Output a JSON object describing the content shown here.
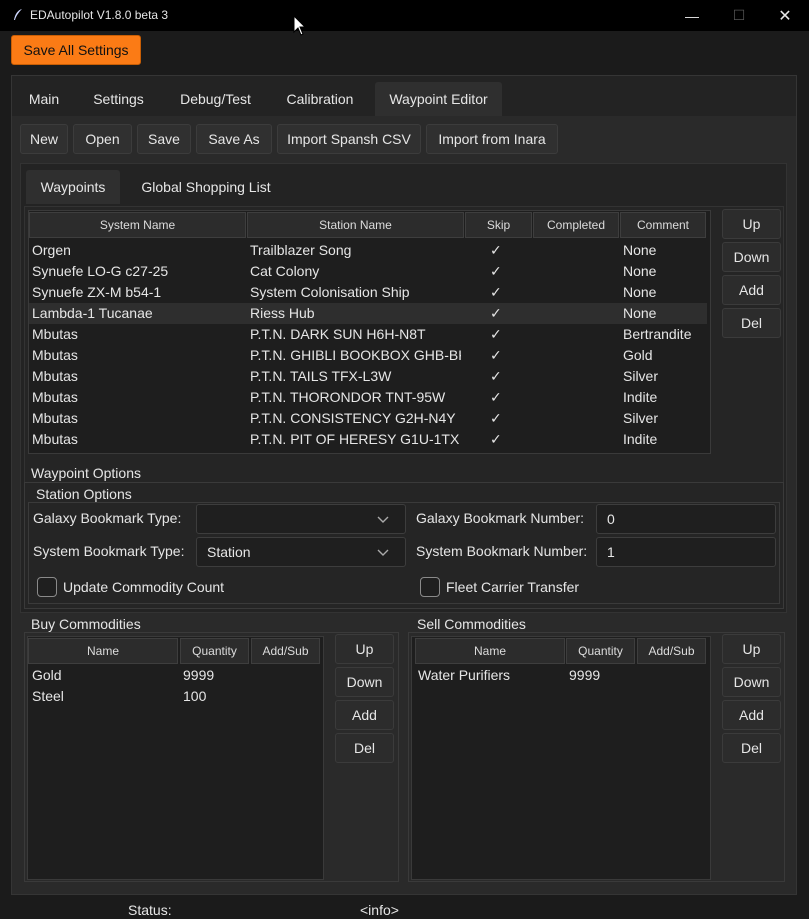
{
  "window": {
    "title": "EDAutopilot V1.8.0 beta 3",
    "minimize": "—",
    "maximize": "☐",
    "close": "✕"
  },
  "save_all": "Save All Settings",
  "tabs": [
    "Main",
    "Settings",
    "Debug/Test",
    "Calibration",
    "Waypoint Editor"
  ],
  "active_tab": "Waypoint Editor",
  "toolbar": [
    "New",
    "Open",
    "Save",
    "Save As",
    "Import Spansh CSV",
    "Import from Inara"
  ],
  "subtabs": [
    "Waypoints",
    "Global Shopping List"
  ],
  "waypoints": {
    "columns": [
      "System Name",
      "Station Name",
      "Skip",
      "Completed",
      "Comment"
    ],
    "rows": [
      {
        "system": "Orgen",
        "station": "Trailblazer Song",
        "skip": "✓",
        "completed": "",
        "comment": "None"
      },
      {
        "system": "Synuefe LO-G c27-25",
        "station": "Cat Colony",
        "skip": "✓",
        "completed": "",
        "comment": "None"
      },
      {
        "system": "Synuefe ZX-M b54-1",
        "station": "System Colonisation Ship",
        "skip": "✓",
        "completed": "",
        "comment": "None"
      },
      {
        "system": "Lambda-1 Tucanae",
        "station": "Riess Hub",
        "skip": "✓",
        "completed": "",
        "comment": "None"
      },
      {
        "system": "Mbutas",
        "station": "P.T.N. DARK SUN H6H-N8T",
        "skip": "✓",
        "completed": "",
        "comment": "Bertrandite"
      },
      {
        "system": "Mbutas",
        "station": "P.T.N. GHIBLI BOOKBOX GHB-BK",
        "skip": "✓",
        "completed": "",
        "comment": "Gold"
      },
      {
        "system": "Mbutas",
        "station": "P.T.N. TAILS TFX-L3W",
        "skip": "✓",
        "completed": "",
        "comment": "Silver"
      },
      {
        "system": "Mbutas",
        "station": "P.T.N. THORONDOR TNT-95W",
        "skip": "✓",
        "completed": "",
        "comment": "Indite"
      },
      {
        "system": "Mbutas",
        "station": "P.T.N. CONSISTENCY G2H-N4Y",
        "skip": "✓",
        "completed": "",
        "comment": "Silver"
      },
      {
        "system": "Mbutas",
        "station": "P.T.N. PIT OF HERESY G1U-1TX",
        "skip": "✓",
        "completed": "",
        "comment": "Indite"
      }
    ],
    "selected_row": 3,
    "buttons": [
      "Up",
      "Down",
      "Add",
      "Del"
    ]
  },
  "waypoint_options": {
    "label": "Waypoint Options",
    "station_options": "Station Options",
    "galaxy_bookmark_type_label": "Galaxy Bookmark Type:",
    "galaxy_bookmark_type_value": "",
    "system_bookmark_type_label": "System Bookmark Type:",
    "system_bookmark_type_value": "Station",
    "galaxy_bookmark_number_label": "Galaxy Bookmark Number:",
    "galaxy_bookmark_number_value": "0",
    "system_bookmark_number_label": "System Bookmark Number:",
    "system_bookmark_number_value": "1",
    "update_commodity_count": "Update Commodity Count",
    "fleet_carrier_transfer": "Fleet Carrier Transfer"
  },
  "buy": {
    "label": "Buy Commodities",
    "columns": [
      "Name",
      "Quantity",
      "Add/Sub"
    ],
    "rows": [
      {
        "name": "Gold",
        "quantity": "9999",
        "addsub": ""
      },
      {
        "name": "Steel",
        "quantity": "100",
        "addsub": ""
      }
    ],
    "buttons": [
      "Up",
      "Down",
      "Add",
      "Del"
    ]
  },
  "sell": {
    "label": "Sell Commodities",
    "columns": [
      "Name",
      "Quantity",
      "Add/Sub"
    ],
    "rows": [
      {
        "name": "Water Purifiers",
        "quantity": "9999",
        "addsub": ""
      }
    ],
    "buttons": [
      "Up",
      "Down",
      "Add",
      "Del"
    ]
  },
  "status": {
    "label": "Status:",
    "value": "<info>"
  },
  "colors": {
    "accent": "#fb7b15",
    "background": "#1b1b1b",
    "panel": "#252525"
  }
}
